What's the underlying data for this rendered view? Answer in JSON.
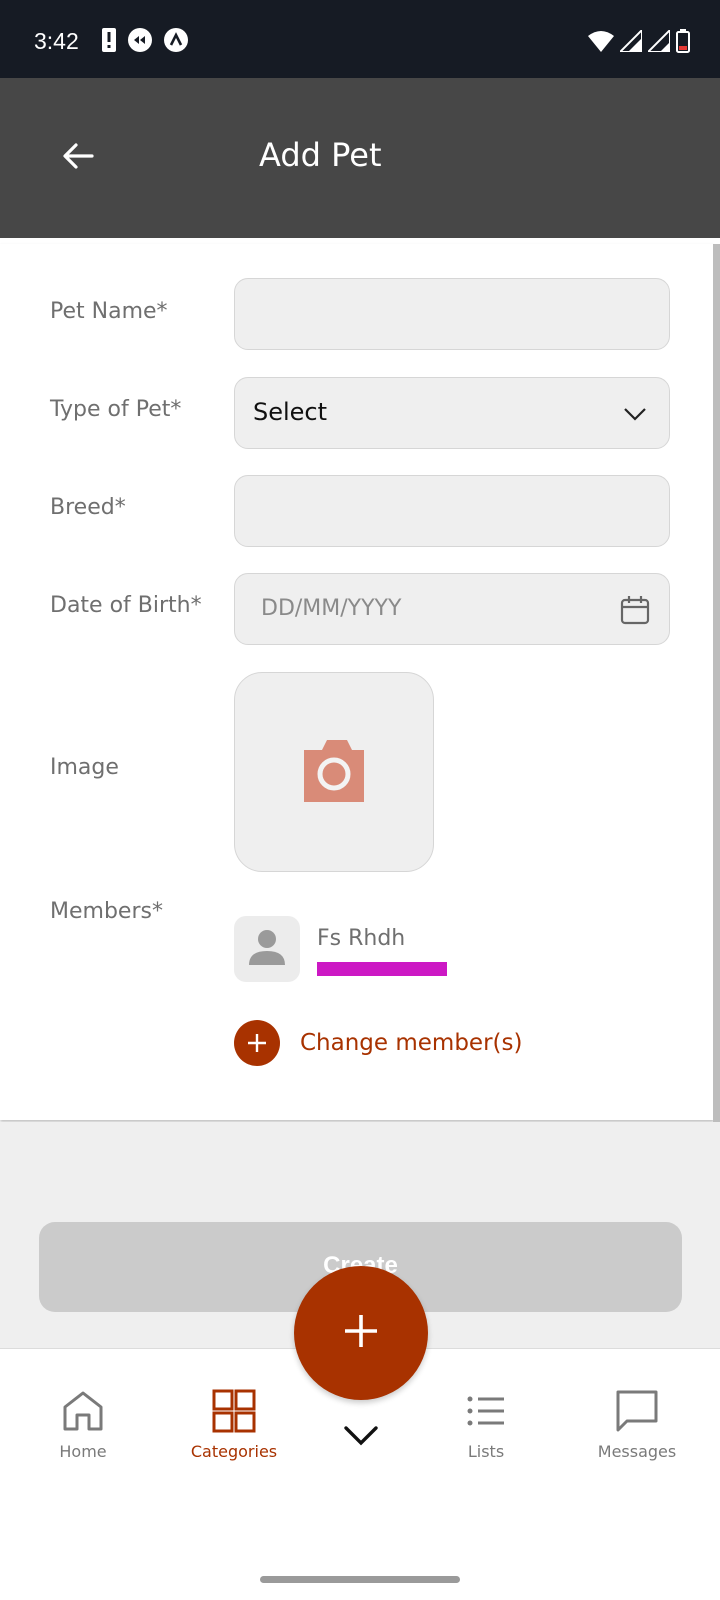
{
  "status_bar": {
    "time": "3:42"
  },
  "app_bar": {
    "title": "Add Pet"
  },
  "form": {
    "pet_name": {
      "label": "Pet Name*",
      "value": ""
    },
    "type_of_pet": {
      "label": "Type of Pet*",
      "value": "Select"
    },
    "breed": {
      "label": "Breed*",
      "value": ""
    },
    "date_of_birth": {
      "label": "Date of Birth*",
      "placeholder": "DD/MM/YYYY"
    },
    "image": {
      "label": "Image"
    },
    "members": {
      "label": "Members*",
      "items": [
        {
          "name": "Fs Rhdh"
        }
      ],
      "change_label": "Change member(s)"
    }
  },
  "create_button": {
    "label": "Create"
  },
  "bottom_nav": {
    "items": [
      {
        "label": "Home",
        "icon": "home-icon"
      },
      {
        "label": "Categories",
        "icon": "categories-icon",
        "active": true
      },
      {
        "label": "Lists",
        "icon": "list-icon"
      },
      {
        "label": "Messages",
        "icon": "message-icon"
      }
    ]
  },
  "colors": {
    "accent": "#a83200",
    "app_bar": "#474747",
    "status_bar": "#161b24",
    "redaction": "#cc18c4"
  }
}
